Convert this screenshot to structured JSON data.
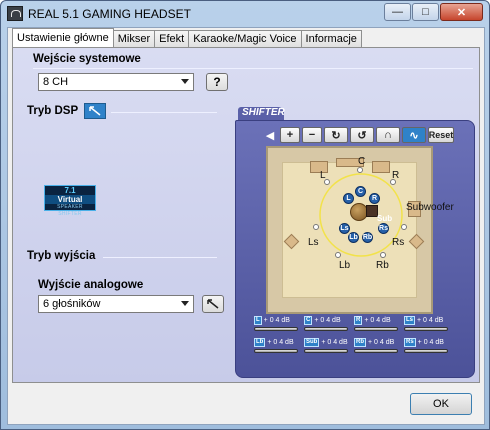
{
  "window": {
    "title": "REAL 5.1 GAMING HEADSET",
    "minimize": "—",
    "maximize": "□",
    "close": "✕"
  },
  "tabs": [
    {
      "label": "Ustawienie główne",
      "active": true
    },
    {
      "label": "Mikser",
      "active": false
    },
    {
      "label": "Efekt",
      "active": false
    },
    {
      "label": "Karaoke/Magic Voice",
      "active": false
    },
    {
      "label": "Informacje",
      "active": false
    }
  ],
  "system_input": {
    "heading": "Wejście systemowe",
    "selected": "8 CH",
    "help_label": "?"
  },
  "dsp": {
    "heading": "Tryb DSP",
    "badge_top": "7.1",
    "badge_mid": "Virtual",
    "badge_bottom": "SPEAKER SHIFTER"
  },
  "output": {
    "heading": "Tryb wyjścia",
    "analog_heading": "Wyjście analogowe",
    "selected": "6 głośników"
  },
  "shifter": {
    "tab_label": "SHIFTER",
    "reset_label": "Reset",
    "plus": "+",
    "minus": "−",
    "room_labels": {
      "c": "C",
      "l": "L",
      "r": "R",
      "ls": "Ls",
      "rs": "Rs",
      "lb": "Lb",
      "rb": "Rb",
      "subwoofer": "Subwoofer",
      "sub": "Sub"
    },
    "chips": {
      "l": "L",
      "c": "C",
      "r": "R",
      "ls": "Ls",
      "rs": "Rs",
      "lb": "Lb",
      "rb": "Rb"
    },
    "levels": [
      {
        "tag": "L",
        "value": "+ 0 4 dB"
      },
      {
        "tag": "C",
        "value": "+ 0 4 dB"
      },
      {
        "tag": "R",
        "value": "+ 0 4 dB"
      },
      {
        "tag": "Ls",
        "value": "+ 0 4 dB"
      },
      {
        "tag": "Lb",
        "value": "+ 0 4 dB"
      },
      {
        "tag": "Sub",
        "value": "+ 0 4 dB"
      },
      {
        "tag": "Rb",
        "value": "+ 0 4 dB"
      },
      {
        "tag": "Rs",
        "value": "+ 0 4 dB"
      }
    ]
  },
  "footer": {
    "ok_label": "OK"
  }
}
